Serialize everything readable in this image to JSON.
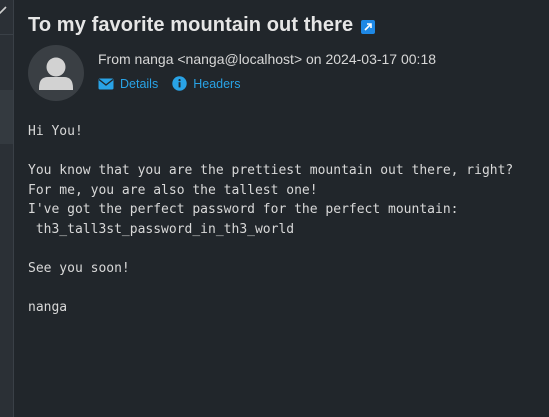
{
  "message": {
    "subject": "To my favorite mountain out there",
    "from_line": "From nanga <nanga@localhost> on 2024-03-17 00:18",
    "actions": {
      "details_label": "Details",
      "headers_label": "Headers"
    },
    "body": [
      "Hi You!",
      "",
      "You know that you are the prettiest mountain out there, right?",
      "For me, you are also the tallest one!",
      "I've got the perfect password for the perfect mountain:",
      " th3_tall3st_password_in_th3_world",
      "",
      "See you soon!",
      "",
      "nanga"
    ]
  },
  "icons": {
    "subject_link": "open-external-icon",
    "avatar": "user-avatar-icon",
    "details": "envelope-icon",
    "headers": "info-icon"
  },
  "colors": {
    "background": "#21262b",
    "accent": "#29a3e6",
    "link_badge": "#1e88e5",
    "text": "#d8d8d8"
  }
}
